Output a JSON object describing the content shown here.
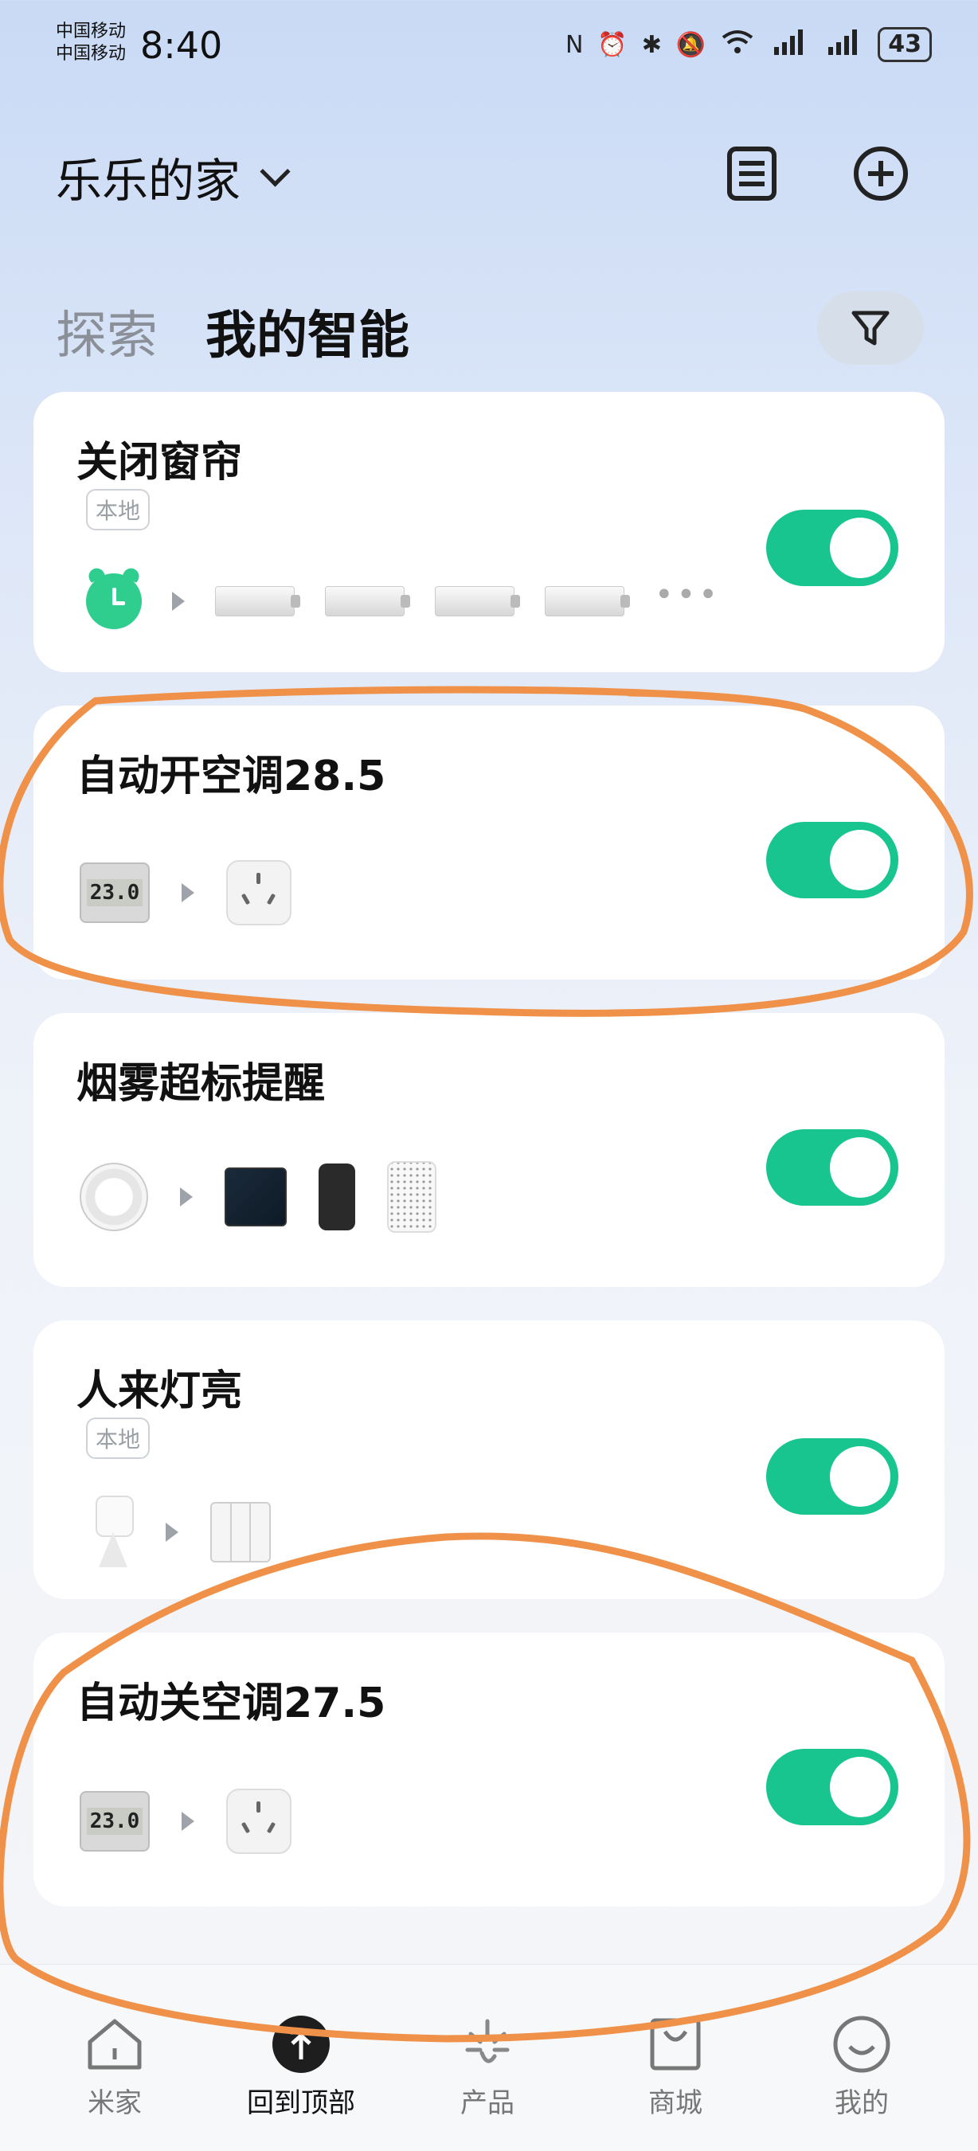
{
  "status_bar": {
    "carrier1": "中国移动",
    "carrier2": "中国移动",
    "time": "8:40",
    "battery": "43"
  },
  "header": {
    "home_name": "乐乐的家",
    "menu_icon": "list-icon",
    "add_icon": "plus-circle-icon"
  },
  "tabs": {
    "explore": "探索",
    "mine": "我的智能",
    "filter_icon": "filter-icon"
  },
  "scenes": [
    {
      "title": "关闭窗帘",
      "badge": "本地",
      "enabled": true
    },
    {
      "title": "自动开空调28.5",
      "badge": "",
      "enabled": true
    },
    {
      "title": "烟雾超标提醒",
      "badge": "",
      "enabled": true
    },
    {
      "title": "人来灯亮",
      "badge": "本地",
      "enabled": true
    },
    {
      "title": "自动关空调27.5",
      "badge": "",
      "enabled": true
    }
  ],
  "thermo_reading": "23.0",
  "more_dots": "•••",
  "nav": {
    "home": "米家",
    "top": "回到顶部",
    "products": "产品",
    "mall": "商城",
    "mine": "我的"
  },
  "colors": {
    "accent": "#18c58f",
    "annotation": "#f0914a"
  }
}
